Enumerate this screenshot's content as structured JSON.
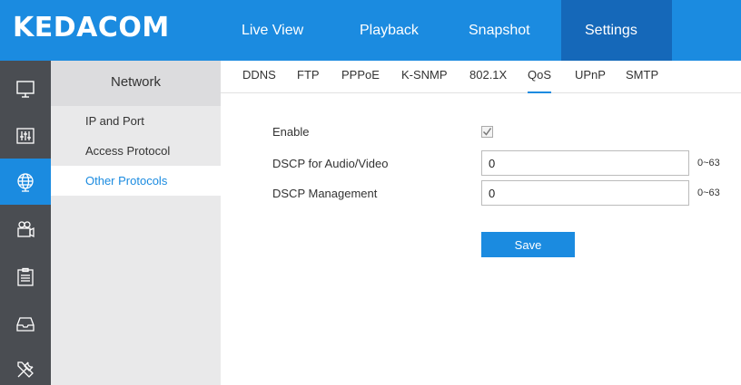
{
  "app": {
    "brand": "KEDACOM"
  },
  "topnav": {
    "items": [
      {
        "label": "Live View"
      },
      {
        "label": "Playback"
      },
      {
        "label": "Snapshot"
      },
      {
        "label": "Settings",
        "active": true
      }
    ]
  },
  "rail": {
    "items": [
      {
        "icon": "monitor-icon"
      },
      {
        "icon": "equalizer-icon"
      },
      {
        "icon": "globe-network-icon",
        "active": true
      },
      {
        "icon": "camera-icon"
      },
      {
        "icon": "clipboard-list-icon"
      },
      {
        "icon": "storage-tray-icon"
      },
      {
        "icon": "tools-icon"
      }
    ]
  },
  "submenu": {
    "title": "Network",
    "items": [
      {
        "label": "IP and Port"
      },
      {
        "label": "Access Protocol"
      },
      {
        "label": "Other Protocols",
        "active": true
      }
    ]
  },
  "subtabs": {
    "items": [
      {
        "label": "DDNS"
      },
      {
        "label": "FTP"
      },
      {
        "label": "PPPoE"
      },
      {
        "label": "K-SNMP"
      },
      {
        "label": "802.1X"
      },
      {
        "label": "QoS",
        "active": true
      },
      {
        "label": "UPnP"
      },
      {
        "label": "SMTP"
      }
    ]
  },
  "form": {
    "enable_label": "Enable",
    "enable_checked": true,
    "dscp_av_label": "DSCP for Audio/Video",
    "dscp_av_value": "0",
    "dscp_av_range": "0~63",
    "dscp_mgmt_label": "DSCP Management",
    "dscp_mgmt_value": "0",
    "dscp_mgmt_range": "0~63",
    "save_label": "Save"
  },
  "colors": {
    "accent": "#1b8be0",
    "accent_dark": "#1568b9",
    "rail_bg": "#4a4d52",
    "submenu_bg": "#e9e9ea"
  }
}
